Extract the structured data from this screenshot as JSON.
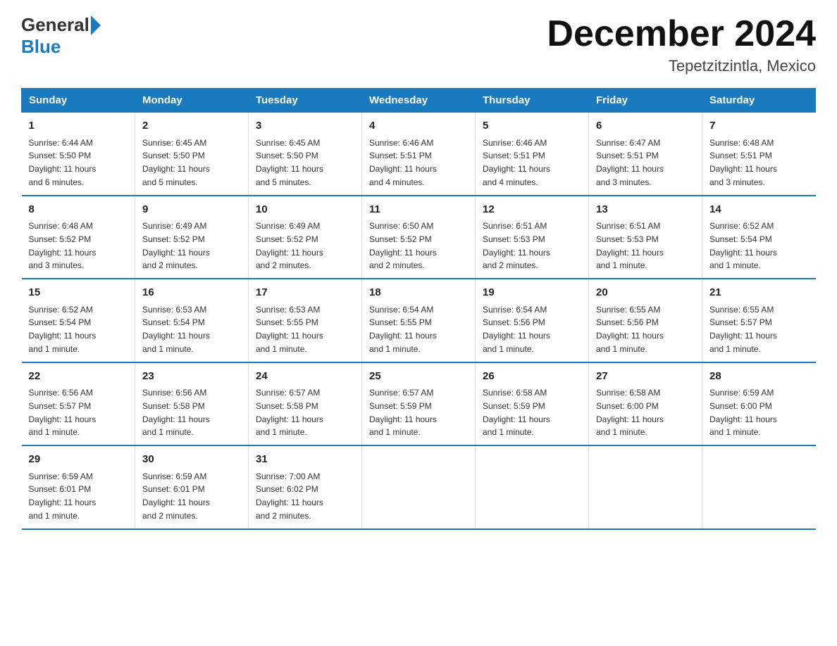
{
  "header": {
    "logo_general": "General",
    "logo_blue": "Blue",
    "month_title": "December 2024",
    "location": "Tepetzitzintla, Mexico"
  },
  "days_of_week": [
    "Sunday",
    "Monday",
    "Tuesday",
    "Wednesday",
    "Thursday",
    "Friday",
    "Saturday"
  ],
  "weeks": [
    [
      {
        "day": "1",
        "sunrise": "6:44 AM",
        "sunset": "5:50 PM",
        "daylight": "11 hours and 6 minutes."
      },
      {
        "day": "2",
        "sunrise": "6:45 AM",
        "sunset": "5:50 PM",
        "daylight": "11 hours and 5 minutes."
      },
      {
        "day": "3",
        "sunrise": "6:45 AM",
        "sunset": "5:50 PM",
        "daylight": "11 hours and 5 minutes."
      },
      {
        "day": "4",
        "sunrise": "6:46 AM",
        "sunset": "5:51 PM",
        "daylight": "11 hours and 4 minutes."
      },
      {
        "day": "5",
        "sunrise": "6:46 AM",
        "sunset": "5:51 PM",
        "daylight": "11 hours and 4 minutes."
      },
      {
        "day": "6",
        "sunrise": "6:47 AM",
        "sunset": "5:51 PM",
        "daylight": "11 hours and 3 minutes."
      },
      {
        "day": "7",
        "sunrise": "6:48 AM",
        "sunset": "5:51 PM",
        "daylight": "11 hours and 3 minutes."
      }
    ],
    [
      {
        "day": "8",
        "sunrise": "6:48 AM",
        "sunset": "5:52 PM",
        "daylight": "11 hours and 3 minutes."
      },
      {
        "day": "9",
        "sunrise": "6:49 AM",
        "sunset": "5:52 PM",
        "daylight": "11 hours and 2 minutes."
      },
      {
        "day": "10",
        "sunrise": "6:49 AM",
        "sunset": "5:52 PM",
        "daylight": "11 hours and 2 minutes."
      },
      {
        "day": "11",
        "sunrise": "6:50 AM",
        "sunset": "5:52 PM",
        "daylight": "11 hours and 2 minutes."
      },
      {
        "day": "12",
        "sunrise": "6:51 AM",
        "sunset": "5:53 PM",
        "daylight": "11 hours and 2 minutes."
      },
      {
        "day": "13",
        "sunrise": "6:51 AM",
        "sunset": "5:53 PM",
        "daylight": "11 hours and 1 minute."
      },
      {
        "day": "14",
        "sunrise": "6:52 AM",
        "sunset": "5:54 PM",
        "daylight": "11 hours and 1 minute."
      }
    ],
    [
      {
        "day": "15",
        "sunrise": "6:52 AM",
        "sunset": "5:54 PM",
        "daylight": "11 hours and 1 minute."
      },
      {
        "day": "16",
        "sunrise": "6:53 AM",
        "sunset": "5:54 PM",
        "daylight": "11 hours and 1 minute."
      },
      {
        "day": "17",
        "sunrise": "6:53 AM",
        "sunset": "5:55 PM",
        "daylight": "11 hours and 1 minute."
      },
      {
        "day": "18",
        "sunrise": "6:54 AM",
        "sunset": "5:55 PM",
        "daylight": "11 hours and 1 minute."
      },
      {
        "day": "19",
        "sunrise": "6:54 AM",
        "sunset": "5:56 PM",
        "daylight": "11 hours and 1 minute."
      },
      {
        "day": "20",
        "sunrise": "6:55 AM",
        "sunset": "5:56 PM",
        "daylight": "11 hours and 1 minute."
      },
      {
        "day": "21",
        "sunrise": "6:55 AM",
        "sunset": "5:57 PM",
        "daylight": "11 hours and 1 minute."
      }
    ],
    [
      {
        "day": "22",
        "sunrise": "6:56 AM",
        "sunset": "5:57 PM",
        "daylight": "11 hours and 1 minute."
      },
      {
        "day": "23",
        "sunrise": "6:56 AM",
        "sunset": "5:58 PM",
        "daylight": "11 hours and 1 minute."
      },
      {
        "day": "24",
        "sunrise": "6:57 AM",
        "sunset": "5:58 PM",
        "daylight": "11 hours and 1 minute."
      },
      {
        "day": "25",
        "sunrise": "6:57 AM",
        "sunset": "5:59 PM",
        "daylight": "11 hours and 1 minute."
      },
      {
        "day": "26",
        "sunrise": "6:58 AM",
        "sunset": "5:59 PM",
        "daylight": "11 hours and 1 minute."
      },
      {
        "day": "27",
        "sunrise": "6:58 AM",
        "sunset": "6:00 PM",
        "daylight": "11 hours and 1 minute."
      },
      {
        "day": "28",
        "sunrise": "6:59 AM",
        "sunset": "6:00 PM",
        "daylight": "11 hours and 1 minute."
      }
    ],
    [
      {
        "day": "29",
        "sunrise": "6:59 AM",
        "sunset": "6:01 PM",
        "daylight": "11 hours and 1 minute."
      },
      {
        "day": "30",
        "sunrise": "6:59 AM",
        "sunset": "6:01 PM",
        "daylight": "11 hours and 2 minutes."
      },
      {
        "day": "31",
        "sunrise": "7:00 AM",
        "sunset": "6:02 PM",
        "daylight": "11 hours and 2 minutes."
      },
      null,
      null,
      null,
      null
    ]
  ],
  "labels": {
    "sunrise": "Sunrise:",
    "sunset": "Sunset:",
    "daylight": "Daylight:"
  }
}
